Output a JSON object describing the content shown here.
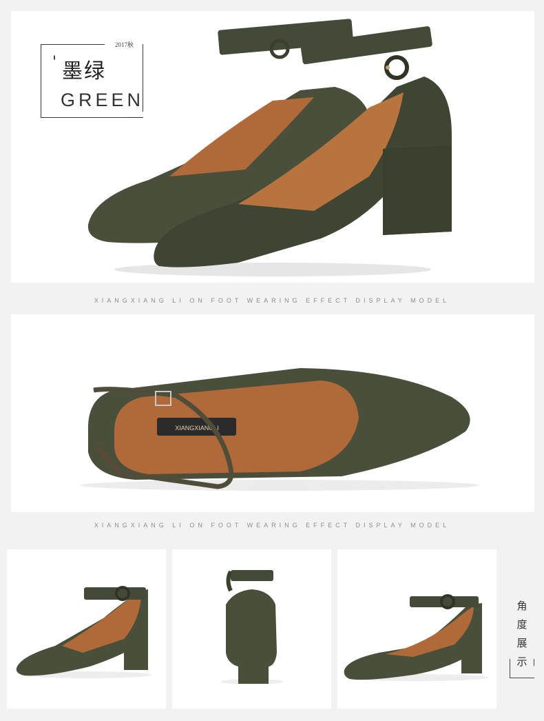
{
  "label": {
    "tick": "'",
    "color_cn": "墨绿",
    "season": "2017秋",
    "color_en": "GREEN"
  },
  "captions": {
    "caption_1": "XIANGXIANG LI ON FOOT WEARING EFFECT DISPLAY MODEL",
    "caption_2": "XIANGXIANG LI ON FOOT WEARING EFFECT DISPLAY MODEL"
  },
  "insole_brand": "XIANGXIANGLI",
  "side_label": [
    "角",
    "度",
    "展",
    "示"
  ],
  "colors": {
    "suede_green": "#4a4f3c",
    "suede_dark": "#3a3f2e",
    "leather_lining": "#b06a3a",
    "panel_bg": "#ffffff",
    "page_bg": "#f2f2f2"
  }
}
